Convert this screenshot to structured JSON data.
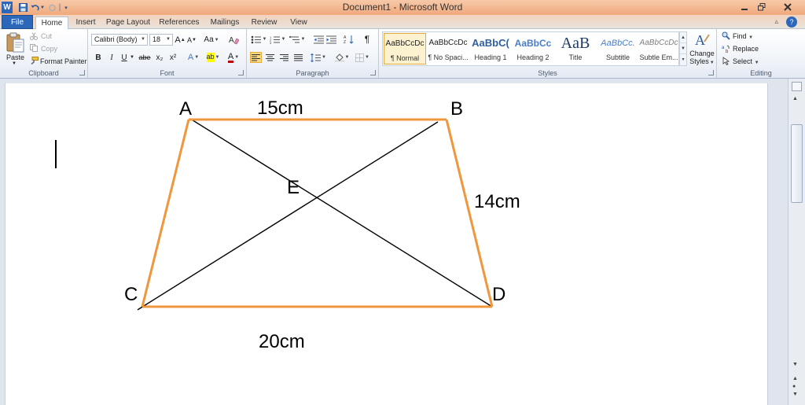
{
  "window": {
    "title": "Document1  -  Microsoft Word",
    "quick_access_separator": "|"
  },
  "tabs": [
    {
      "label": "File"
    },
    {
      "label": "Home"
    },
    {
      "label": "Insert"
    },
    {
      "label": "Page Layout"
    },
    {
      "label": "References"
    },
    {
      "label": "Mailings"
    },
    {
      "label": "Review"
    },
    {
      "label": "View"
    }
  ],
  "ribbon": {
    "clipboard": {
      "group_label": "Clipboard",
      "paste_label": "Paste",
      "cut_label": "Cut",
      "copy_label": "Copy",
      "format_painter_label": "Format Painter"
    },
    "font": {
      "group_label": "Font",
      "font_name": "Calibri (Body)",
      "font_size": "18",
      "grow_label": "A",
      "shrink_label": "A",
      "case_label": "Aa",
      "bold": "B",
      "italic": "I",
      "underline": "U",
      "strike": "abe",
      "subscript": "x₂",
      "superscript": "x²",
      "effects": "A",
      "highlight": "ab",
      "color": "A",
      "accent_color": "#c00000"
    },
    "paragraph": {
      "group_label": "Paragraph",
      "pilcrow": "¶"
    },
    "styles": {
      "group_label": "Styles",
      "items": [
        {
          "preview": "AaBbCcDc",
          "name": "¶ Normal"
        },
        {
          "preview": "AaBbCcDc",
          "name": "¶ No Spaci..."
        },
        {
          "preview": "AaBbC(",
          "name": "Heading 1"
        },
        {
          "preview": "AaBbCc",
          "name": "Heading 2"
        },
        {
          "preview": "AaB",
          "name": "Title"
        },
        {
          "preview": "AaBbCc.",
          "name": "Subtitle"
        },
        {
          "preview": "AaBbCcDc",
          "name": "Subtle Em..."
        }
      ],
      "change_styles_label": "Change",
      "change_styles_label2": "Styles"
    },
    "editing": {
      "group_label": "Editing",
      "find_label": "Find",
      "replace_label": "Replace",
      "select_label": "Select"
    }
  },
  "document": {
    "shape_color": "#f0963c",
    "line_color": "#000000",
    "vertices": {
      "a": "A",
      "b": "B",
      "c": "C",
      "d": "D",
      "e": "E"
    },
    "labels": {
      "top": "15cm",
      "right": "14cm",
      "bottom": "20cm"
    }
  }
}
